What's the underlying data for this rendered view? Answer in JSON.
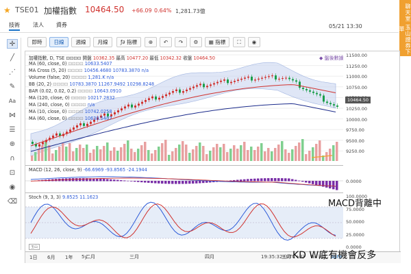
{
  "header": {
    "symbol": "TSE01",
    "name": "加權指數",
    "price": "10464.50",
    "change": "+66.09",
    "change_pct": "0.64%",
    "volume": "1,281.73億"
  },
  "tabs": [
    "技術",
    "法人",
    "資券"
  ],
  "timestamp": "05/21 13:30",
  "banner": "聊天室 玉山證券下單",
  "toolbar": [
    "即時",
    "日線",
    "週線",
    "月線",
    "指標",
    "指標"
  ],
  "chart_title_row": {
    "name": "加權指數, D, TSE",
    "open_label": "開盤",
    "open": "10362.35",
    "high_label": "最高",
    "high": "10477.20",
    "low_label": "最低",
    "low": "10342.32",
    "close_label": "收盤",
    "close": "10464.50"
  },
  "indicators": [
    {
      "label": "MA (60, close, 0)",
      "value": "10633.5407"
    },
    {
      "label": "MA Cross (5, 20)",
      "value": "10456.4680 10783.3870 n/a"
    },
    {
      "label": "Volume (false, 20)",
      "value": "1,281.K n/a"
    },
    {
      "label": "BB (20, 2)",
      "value": "10783.3870 11267.9492 10298.8248"
    },
    {
      "label": "BAR (0.02, 0.02, 0.2)",
      "value": "10643.0910"
    },
    {
      "label": "MA (120, close, 0)",
      "value": "10217.2832"
    },
    {
      "label": "MA (240, close, 0)",
      "value": "n/a"
    },
    {
      "label": "MA (10, close, 0)",
      "value": "10742.0258"
    },
    {
      "label": "MA (60, close, 0)",
      "value": "10638.5407"
    }
  ],
  "legend_entry": "◆ 盤後數據",
  "price_tag": "10464.50",
  "main_y_ticks": [
    "11500.00",
    "11250.00",
    "11000.00",
    "10750.00",
    "10500.00",
    "10250.00",
    "10000.00",
    "9750.00",
    "9500.00",
    "9250.00"
  ],
  "macd": {
    "label": "MACD (12, 26, close, 9)",
    "value": "-66.6969 -93.8565 -24.1944",
    "y_tick": "0.0000"
  },
  "stoch": {
    "label": "Stoch (9, 3, 3)",
    "value": "9.8525 11.1623",
    "y_ticks": [
      "100.0000",
      "75.0000",
      "50.0000",
      "25.0000",
      "0.0000"
    ]
  },
  "x_axis": {
    "ranges": [
      "1日",
      "6月",
      "1年",
      "5y"
    ],
    "months": [
      "二月",
      "三月",
      "四月",
      "五月"
    ],
    "clock": "19:35:32 (UTC+8)",
    "mode_labels": [
      "%",
      "log",
      "auto"
    ]
  },
  "annotations": {
    "macd": "MACD背離中",
    "kd": "KD W底有機會反多"
  },
  "colors": {
    "up": "#d0312d",
    "down": "#1a9e4a",
    "accent": "#1a73c8",
    "stoch_k": "#2d5bd8",
    "stoch_d": "#d0312d"
  },
  "left_tools": [
    "crosshair-icon",
    "trendline-icon",
    "fibonacci-icon",
    "brush-icon",
    "text-icon",
    "pattern-icon",
    "fib-retracement-icon",
    "zoom-icon",
    "magnet-icon",
    "lock-icon",
    "eye-icon",
    "trash-icon"
  ]
}
